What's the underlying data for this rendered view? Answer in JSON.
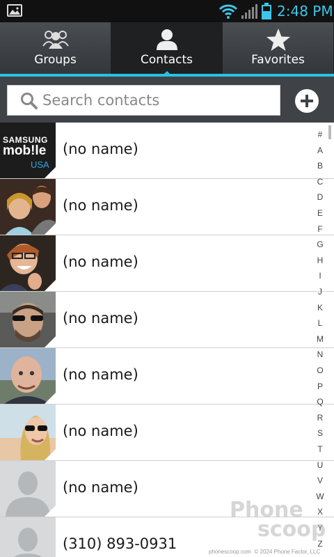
{
  "status_bar": {
    "time": "2:48 PM"
  },
  "tabs": [
    {
      "label": "Groups",
      "icon": "groups-icon",
      "active": false
    },
    {
      "label": "Contacts",
      "icon": "contact-icon",
      "active": true
    },
    {
      "label": "Favorites",
      "icon": "star-icon",
      "active": false
    }
  ],
  "search": {
    "placeholder": "Search contacts"
  },
  "colors": {
    "accent": "#27c2e6",
    "tab_bg": "#3a3d40",
    "status_text": "#3ec6e8"
  },
  "contacts": [
    {
      "name": "(no name)",
      "avatar": "samsung-mobile-usa-logo",
      "logo_line1": "SAMSUNG",
      "logo_line2": "mob!le",
      "logo_line3": "USA"
    },
    {
      "name": "(no name)",
      "avatar": "photo-couple"
    },
    {
      "name": "(no name)",
      "avatar": "photo-woman-thumbs-up"
    },
    {
      "name": "(no name)",
      "avatar": "photo-man-sunglasses"
    },
    {
      "name": "(no name)",
      "avatar": "photo-bald-man"
    },
    {
      "name": "(no name)",
      "avatar": "photo-woman-sunglasses"
    },
    {
      "name": "(no name)",
      "avatar": "default-avatar"
    },
    {
      "name": "(310) 893-0931",
      "avatar": "default-avatar"
    }
  ],
  "alpha_index": [
    "#",
    "A",
    "B",
    "C",
    "D",
    "E",
    "F",
    "G",
    "H",
    "I",
    "J",
    "K",
    "L",
    "M",
    "N",
    "O",
    "P",
    "Q",
    "R",
    "S",
    "T",
    "U",
    "V",
    "W",
    "X",
    "Y",
    "Z"
  ],
  "watermark": {
    "line1": "Phone",
    "line2": "scoop"
  },
  "footer": {
    "site": "phonescoop.com",
    "copyright": "© 2024 Phone Factor, LLC"
  }
}
